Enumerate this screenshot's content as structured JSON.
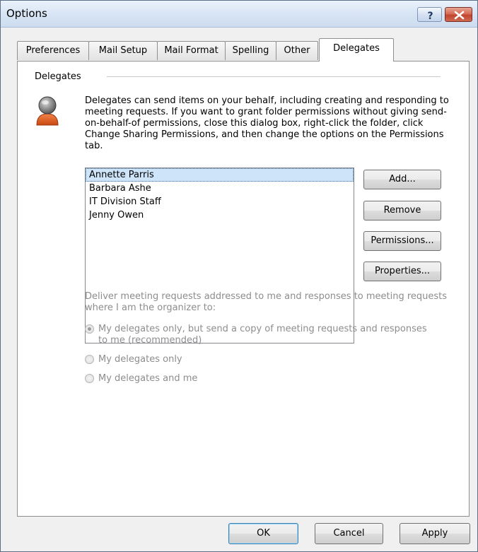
{
  "window": {
    "title": "Options"
  },
  "tabs": [
    {
      "label": "Preferences"
    },
    {
      "label": "Mail Setup"
    },
    {
      "label": "Mail Format"
    },
    {
      "label": "Spelling"
    },
    {
      "label": "Other"
    },
    {
      "label": "Delegates",
      "active": true
    }
  ],
  "delegates": {
    "group_label": "Delegates",
    "description": "Delegates can send items on your behalf, including creating and responding to meeting requests. If you want to grant folder permissions without giving send-on-behalf-of permissions, close this dialog box, right-click the folder, click Change Sharing Permissions, and then change the options on the Permissions tab.",
    "list": [
      {
        "name": "Annette Parris",
        "selected": true
      },
      {
        "name": "Barbara Ashe"
      },
      {
        "name": "IT Division Staff"
      },
      {
        "name": "Jenny Owen"
      }
    ],
    "buttons": {
      "add": "Add...",
      "remove": "Remove",
      "permissions": "Permissions...",
      "properties": "Properties..."
    },
    "deliver_label": "Deliver meeting requests addressed to me and responses to meeting requests where I am the organizer to:",
    "options": [
      {
        "label": "My delegates only, but send a copy of meeting requests and responses to me (recommended)",
        "checked": true,
        "enabled": false
      },
      {
        "label": "My delegates only",
        "checked": false,
        "enabled": false
      },
      {
        "label": "My delegates and me",
        "checked": false,
        "enabled": false
      }
    ]
  },
  "footer": {
    "ok": "OK",
    "cancel": "Cancel",
    "apply": "Apply"
  },
  "icons": {
    "help": "help-icon",
    "close": "close-icon",
    "delegate": "delegate-person-icon"
  },
  "colors": {
    "selection": "#cde4f9",
    "disabled_text": "#8d8d8d",
    "close_button": "#c0452e"
  }
}
